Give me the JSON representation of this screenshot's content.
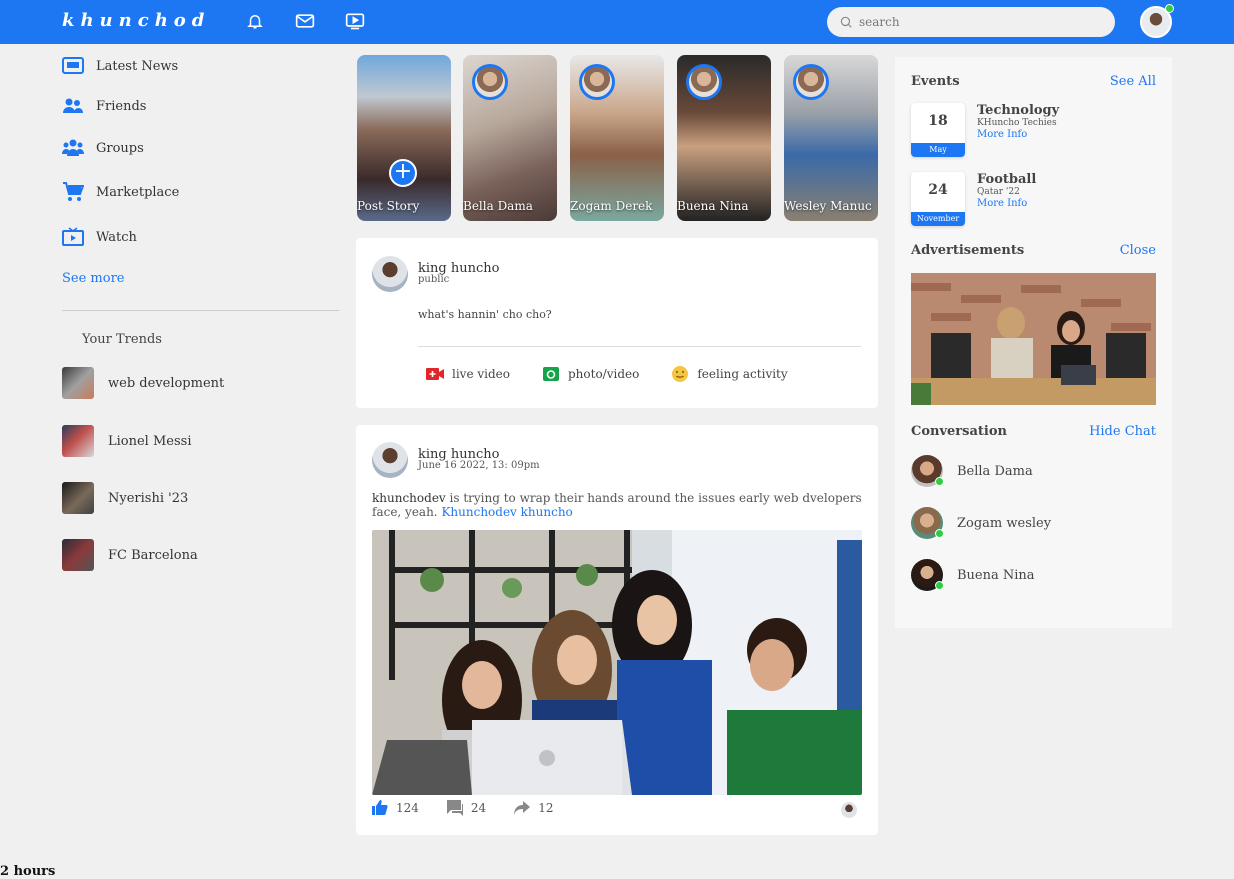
{
  "header": {
    "logo": "khunchod",
    "search_placeholder": "search"
  },
  "sidebar": {
    "items": [
      {
        "label": "Latest News"
      },
      {
        "label": "Friends"
      },
      {
        "label": "Groups"
      },
      {
        "label": "Marketplace"
      },
      {
        "label": "Watch"
      }
    ],
    "see_more": "See more",
    "trends_title": "Your Trends",
    "trends": [
      {
        "label": "web development"
      },
      {
        "label": "Lionel Messi"
      },
      {
        "label": "Nyerishi '23"
      },
      {
        "label": "FC Barcelona"
      }
    ]
  },
  "stories": [
    {
      "label": "Post Story"
    },
    {
      "label": "Bella Dama"
    },
    {
      "label": "Zogam Derek"
    },
    {
      "label": "Buena Nina"
    },
    {
      "label": "Wesley Manuc"
    }
  ],
  "composer": {
    "name": "king huncho",
    "visibility": "public",
    "prompt": "what's hannin' cho cho?",
    "actions": [
      {
        "label": "live video"
      },
      {
        "label": "photo/video"
      },
      {
        "label": "feeling activity"
      }
    ]
  },
  "post": {
    "name": "king huncho",
    "date": "June 16 2022, 13: 09pm",
    "author_handle": "khunchodev",
    "text": " is trying to wrap their hands around the issues early web dvelopers face, yeah. ",
    "tags": "Khunchodev khuncho",
    "likes": "124",
    "comments": "24",
    "shares": "12"
  },
  "events": {
    "title": "Events",
    "see_all": "See All",
    "items": [
      {
        "day": "18",
        "month": "May",
        "title": "Technology",
        "org": "KHuncho Techies",
        "more": "More Info"
      },
      {
        "day": "24",
        "month": "November",
        "title": "Football",
        "org": "Qatar '22",
        "more": "More Info"
      }
    ]
  },
  "ads": {
    "title": "Advertisements",
    "close": "Close"
  },
  "conversation": {
    "title": "Conversation",
    "hide": "Hide Chat",
    "contacts": [
      {
        "name": "Bella Dama"
      },
      {
        "name": "Zogam wesley"
      },
      {
        "name": "Buena Nina"
      }
    ]
  },
  "footer_text": "2 hours",
  "colors": {
    "brand": "#1d77f2",
    "online": "#2ecc40"
  }
}
